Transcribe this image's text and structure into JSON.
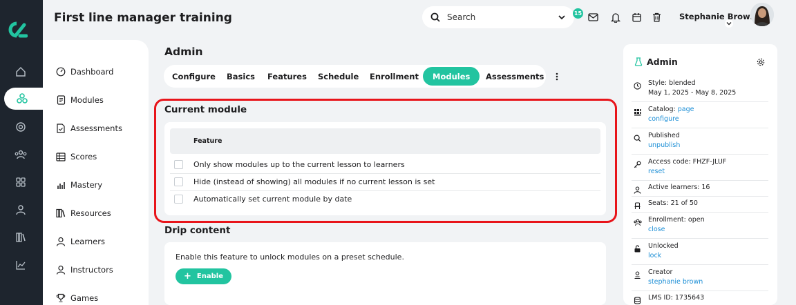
{
  "header": {
    "title": "First line manager training",
    "search_placeholder": "Search",
    "notification_count": "15",
    "user_name": "Stephanie Brown"
  },
  "rail": {
    "icons": [
      "home-icon",
      "modules-icon",
      "target-icon",
      "users-icon",
      "grid-icon",
      "person-icon",
      "library-icon",
      "chart-icon"
    ]
  },
  "subnav": {
    "items": [
      {
        "label": "Dashboard",
        "icon": "dashboard-icon"
      },
      {
        "label": "Modules",
        "icon": "modules-icon"
      },
      {
        "label": "Assessments",
        "icon": "assessments-icon"
      },
      {
        "label": "Scores",
        "icon": "scores-icon"
      },
      {
        "label": "Mastery",
        "icon": "mastery-icon"
      },
      {
        "label": "Resources",
        "icon": "resources-icon"
      },
      {
        "label": "Learners",
        "icon": "learners-icon"
      },
      {
        "label": "Instructors",
        "icon": "instructors-icon"
      },
      {
        "label": "Games",
        "icon": "games-icon"
      }
    ]
  },
  "main": {
    "title": "Admin",
    "tabs": [
      "Configure",
      "Basics",
      "Features",
      "Schedule",
      "Enrollment",
      "Modules",
      "Assessments"
    ],
    "active_tab": "Modules",
    "current_module": {
      "title": "Current module",
      "column": "Feature",
      "rows": [
        "Only show modules up to the current lesson to learners",
        "Hide (instead of showing) all modules if no current lesson is set",
        "Automatically set current module by date"
      ]
    },
    "drip": {
      "title": "Drip content",
      "text": "Enable this feature to unlock modules on a preset schedule.",
      "button": "Enable"
    }
  },
  "panel": {
    "title": "Admin",
    "items": [
      {
        "icon": "clock-icon",
        "line1": "Style: blended",
        "line2": "May 1, 2025 - May 8, 2025",
        "line2_link": false
      },
      {
        "icon": "catalog-icon",
        "line1": "Catalog: ",
        "line1_link": "page",
        "line2": "configure",
        "line2_link": true
      },
      {
        "icon": "search-icon",
        "line1": "Published",
        "line2": "unpublish",
        "line2_link": true
      },
      {
        "icon": "key-icon",
        "line1": "Access code: FHZF-JLUF",
        "line2": "reset",
        "line2_link": true
      },
      {
        "icon": "person-icon",
        "line1": "Active learners: 16"
      },
      {
        "icon": "seat-icon",
        "line1": "Seats: 21 of 50"
      },
      {
        "icon": "group-icon",
        "line1": "Enrollment: open",
        "line2": "close",
        "line2_link": true
      },
      {
        "icon": "unlock-icon",
        "line1": "Unlocked",
        "line2": "lock",
        "line2_link": true
      },
      {
        "icon": "creator-icon",
        "line1": "Creator",
        "line2": "stephanie brown",
        "line2_link": true
      },
      {
        "icon": "database-icon",
        "line1": "LMS ID: 1735643"
      }
    ]
  },
  "colors": {
    "accent": "#22c4a0",
    "rail": "#1e252e",
    "link": "#1d8fd6",
    "highlight": "#e8141a"
  }
}
